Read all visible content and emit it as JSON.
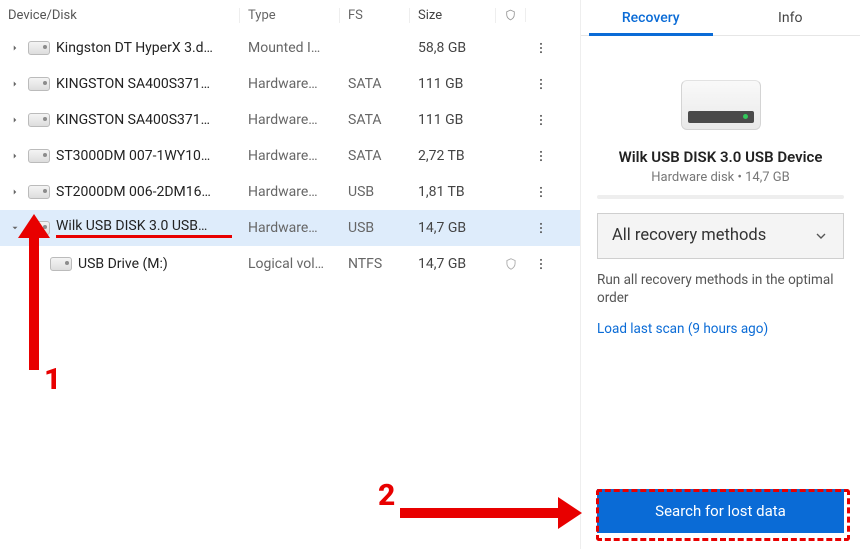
{
  "columns": {
    "name": "Device/Disk",
    "type": "Type",
    "fs": "FS",
    "size": "Size"
  },
  "rows": [
    {
      "name": "Kingston DT HyperX 3.d…",
      "type": "Mounted I…",
      "fs": "",
      "size": "58,8 GB",
      "expanded": false,
      "selected": false,
      "highlighted": false,
      "hasShield": false
    },
    {
      "name": "KINGSTON  SA400S371…",
      "type": "Hardware…",
      "fs": "SATA",
      "size": "111 GB",
      "expanded": false,
      "selected": false,
      "highlighted": false,
      "hasShield": false
    },
    {
      "name": "KINGSTON  SA400S371…",
      "type": "Hardware…",
      "fs": "SATA",
      "size": "111 GB",
      "expanded": false,
      "selected": false,
      "highlighted": false,
      "hasShield": false
    },
    {
      "name": "ST3000DM 007-1WY10…",
      "type": "Hardware…",
      "fs": "SATA",
      "size": "2,72 TB",
      "expanded": false,
      "selected": false,
      "highlighted": false,
      "hasShield": false
    },
    {
      "name": "ST2000DM 006-2DM16…",
      "type": "Hardware…",
      "fs": "USB",
      "size": "1,81 TB",
      "expanded": false,
      "selected": false,
      "highlighted": false,
      "hasShield": false
    },
    {
      "name": "Wilk USB DISK 3.0 USB…",
      "type": "Hardware…",
      "fs": "USB",
      "size": "14,7 GB",
      "expanded": true,
      "selected": true,
      "highlighted": true,
      "hasShield": false,
      "children": [
        {
          "name": "USB Drive (M:)",
          "type": "Logical vol…",
          "fs": "NTFS",
          "size": "14,7 GB",
          "hasShield": true
        }
      ]
    }
  ],
  "side": {
    "tabs": {
      "recovery": "Recovery",
      "info": "Info",
      "active": "recovery"
    },
    "title": "Wilk USB DISK 3.0 USB Device",
    "subtitle": "Hardware disk • 14,7 GB",
    "method": "All recovery methods",
    "method_desc": "Run all recovery methods in the optimal order",
    "last_scan": "Load last scan (9 hours ago)",
    "search_btn": "Search for lost data"
  },
  "annot": {
    "one": "1",
    "two": "2"
  }
}
